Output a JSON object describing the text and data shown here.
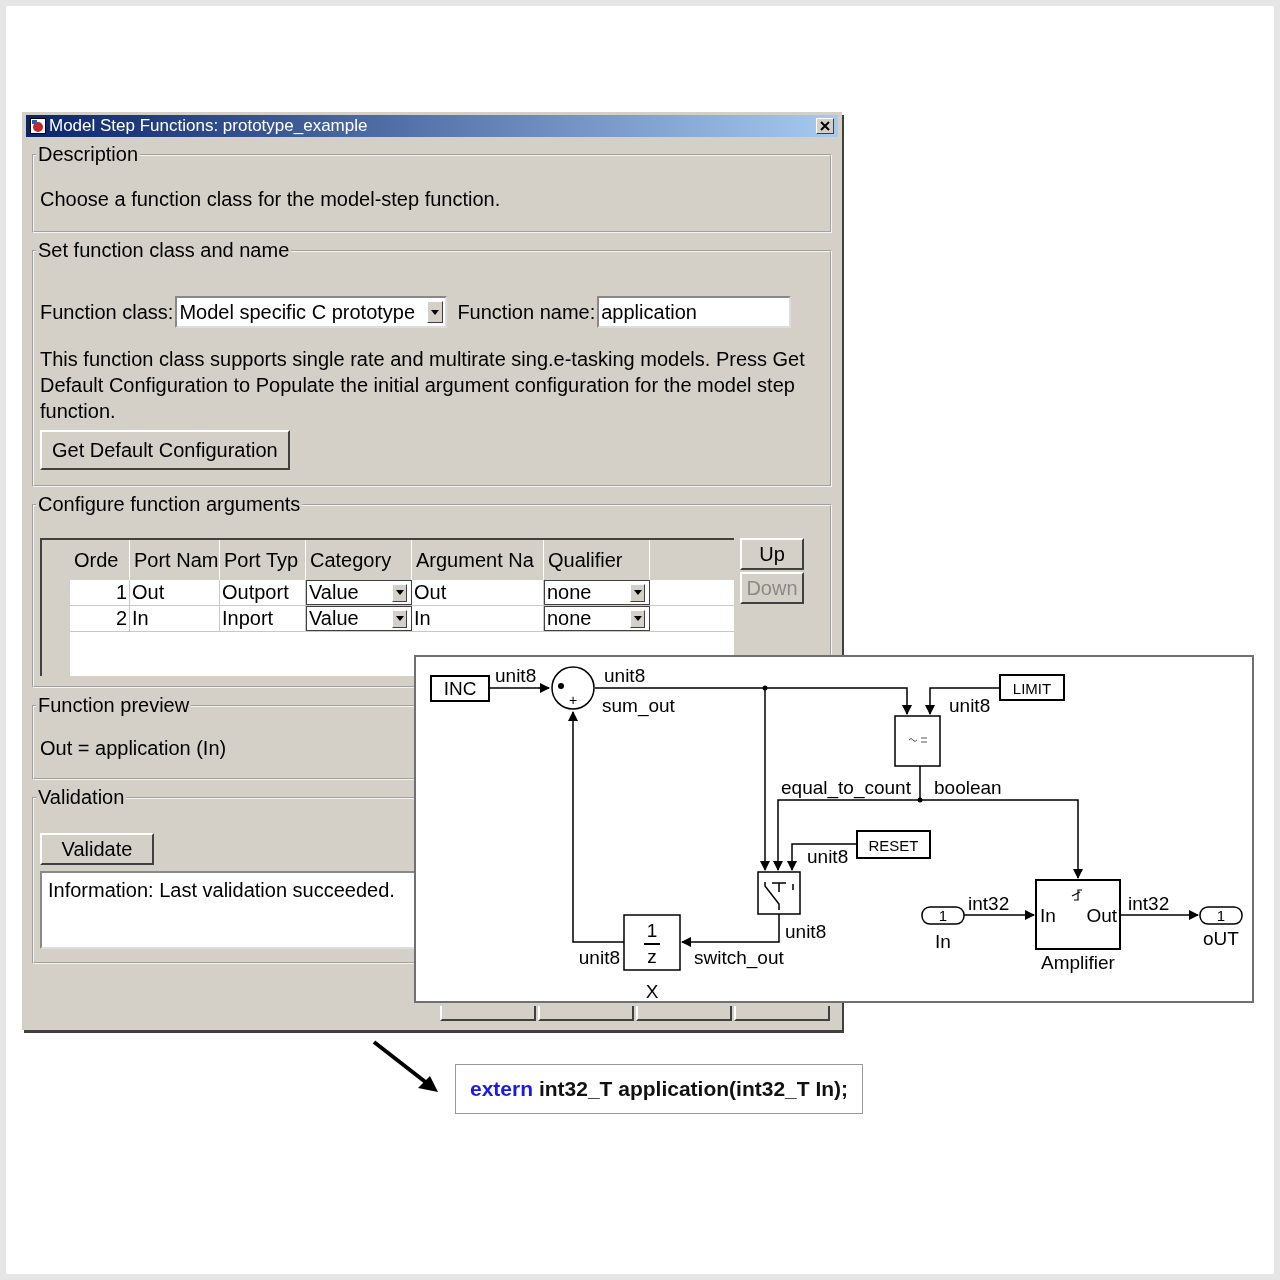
{
  "window": {
    "title": "Model Step Functions: prototype_example"
  },
  "description": {
    "title": "Description",
    "text": "Choose a function class for the model-step function."
  },
  "function_setup": {
    "title": "Set function class and name",
    "class_label": "Function class:",
    "class_value": "Model specific C prototype",
    "name_label": "Function name:",
    "name_value": "application",
    "help_text": "This function class supports single rate and multirate sing.e-tasking models. Press Get Default Configuration to Populate the initial argument configuration for the model step function.",
    "button": "Get Default Configuration"
  },
  "arguments": {
    "title": "Configure function arguments",
    "columns": [
      "Orde",
      "Port Nam",
      "Port Typ",
      "Category",
      "Argument Na",
      "Qualifier"
    ],
    "rows": [
      {
        "order": "1",
        "port_name": "Out",
        "port_type": "Outport",
        "category": "Value",
        "argument_name": "Out",
        "qualifier": "none"
      },
      {
        "order": "2",
        "port_name": "In",
        "port_type": "Inport",
        "category": "Value",
        "argument_name": "In",
        "qualifier": "none"
      }
    ],
    "buttons": [
      {
        "label": "Up",
        "disabled": false
      },
      {
        "label": "Down",
        "disabled": true
      }
    ]
  },
  "preview": {
    "title": "Function preview",
    "text": "Out = application (In)"
  },
  "validation": {
    "title": "Validation",
    "button": "Validate",
    "message": "Information: Last validation succeeded."
  },
  "diagram": {
    "blocks": [
      {
        "kind": "constant",
        "label": "INC"
      },
      {
        "kind": "sum",
        "sign": "+"
      },
      {
        "kind": "constant",
        "label": "LIMIT"
      },
      {
        "kind": "compare"
      },
      {
        "kind": "constant",
        "label": "RESET"
      },
      {
        "kind": "switch"
      },
      {
        "kind": "delay",
        "numerator": "1",
        "denominator": "z",
        "name": "X"
      },
      {
        "kind": "inport",
        "number": "1",
        "name": "In"
      },
      {
        "kind": "subsystem",
        "input": "In",
        "output": "Out",
        "name": "Amplifier"
      },
      {
        "kind": "outport",
        "number": "1",
        "name": "oUT"
      }
    ],
    "signal_labels": [
      "unit8",
      "unit8",
      "sum_out",
      "unit8",
      "equal_to_count",
      "boolean",
      "unit8",
      "unit8",
      "switch_out",
      "unit8",
      "int32",
      "int32"
    ]
  },
  "code": {
    "tokens": [
      {
        "text": "extern",
        "kind": "keyword"
      },
      {
        "text": "int32_T application(int32_T In);",
        "kind": "plain"
      }
    ]
  }
}
